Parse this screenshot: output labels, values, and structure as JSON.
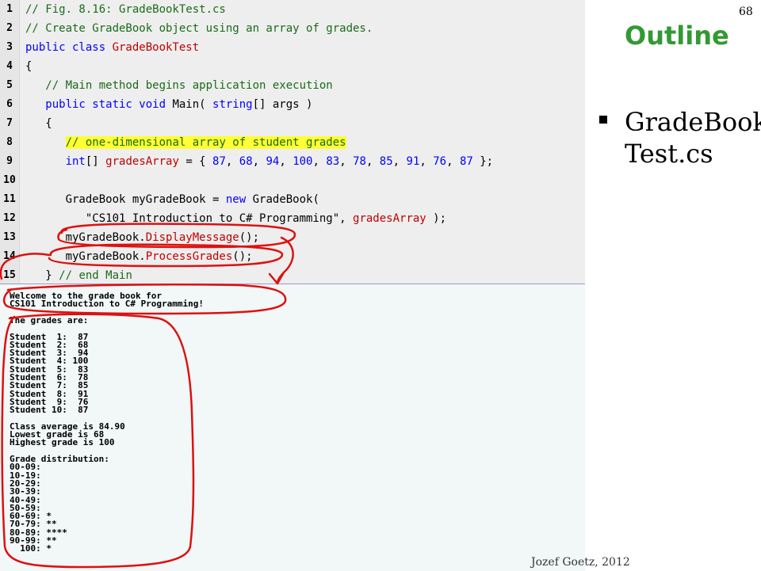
{
  "slide": {
    "page_number": "68",
    "outline_title": "Outline",
    "bullet_text": "GradeBook Test.cs",
    "footer": "Jozef Goetz, 2012"
  },
  "code": [
    {
      "n": "1",
      "tokens": [
        {
          "t": "// Fig. 8.16: GradeBookTest.cs",
          "c": "cm"
        }
      ]
    },
    {
      "n": "2",
      "tokens": [
        {
          "t": "// Create GradeBook object using an array of grades.",
          "c": "cm"
        }
      ]
    },
    {
      "n": "3",
      "tokens": [
        {
          "t": "public class ",
          "c": "kw"
        },
        {
          "t": "GradeBookTest",
          "c": "cls"
        }
      ]
    },
    {
      "n": "4",
      "tokens": [
        {
          "t": "{",
          "c": ""
        }
      ]
    },
    {
      "n": "5",
      "tokens": [
        {
          "t": "   // Main method begins application execution",
          "c": "cm"
        }
      ]
    },
    {
      "n": "6",
      "tokens": [
        {
          "t": "   public static void ",
          "c": "kw"
        },
        {
          "t": "Main( ",
          "c": ""
        },
        {
          "t": "string",
          "c": "kw"
        },
        {
          "t": "[] args )",
          "c": ""
        }
      ]
    },
    {
      "n": "7",
      "tokens": [
        {
          "t": "   {",
          "c": ""
        }
      ]
    },
    {
      "n": "8",
      "tokens": [
        {
          "t": "      ",
          "c": ""
        },
        {
          "t": "// one-dimensional array of student grades",
          "c": "cm hl"
        }
      ]
    },
    {
      "n": "9",
      "tokens": [
        {
          "t": "      ",
          "c": ""
        },
        {
          "t": "int",
          "c": "kw"
        },
        {
          "t": "[] ",
          "c": ""
        },
        {
          "t": "gradesArray",
          "c": "cls"
        },
        {
          "t": " = { ",
          "c": ""
        },
        {
          "t": "87",
          "c": "num"
        },
        {
          "t": ", ",
          "c": ""
        },
        {
          "t": "68",
          "c": "num"
        },
        {
          "t": ", ",
          "c": ""
        },
        {
          "t": "94",
          "c": "num"
        },
        {
          "t": ", ",
          "c": ""
        },
        {
          "t": "100",
          "c": "num"
        },
        {
          "t": ", ",
          "c": ""
        },
        {
          "t": "83",
          "c": "num"
        },
        {
          "t": ", ",
          "c": ""
        },
        {
          "t": "78",
          "c": "num"
        },
        {
          "t": ", ",
          "c": ""
        },
        {
          "t": "85",
          "c": "num"
        },
        {
          "t": ", ",
          "c": ""
        },
        {
          "t": "91",
          "c": "num"
        },
        {
          "t": ", ",
          "c": ""
        },
        {
          "t": "76",
          "c": "num"
        },
        {
          "t": ", ",
          "c": ""
        },
        {
          "t": "87",
          "c": "num"
        },
        {
          "t": " };",
          "c": ""
        }
      ]
    },
    {
      "n": "10",
      "tokens": [
        {
          "t": "",
          "c": ""
        }
      ]
    },
    {
      "n": "11",
      "tokens": [
        {
          "t": "      GradeBook myGradeBook = ",
          "c": ""
        },
        {
          "t": "new",
          "c": "kw"
        },
        {
          "t": " GradeBook(",
          "c": ""
        }
      ]
    },
    {
      "n": "12",
      "tokens": [
        {
          "t": "         \"CS101 Introduction to C# Programming\"",
          "c": "str"
        },
        {
          "t": ", ",
          "c": ""
        },
        {
          "t": "gradesArray",
          "c": "cls"
        },
        {
          "t": " );",
          "c": ""
        }
      ]
    },
    {
      "n": "13",
      "tokens": [
        {
          "t": "      myGradeBook.",
          "c": ""
        },
        {
          "t": "DisplayMessage",
          "c": "cls"
        },
        {
          "t": "();",
          "c": ""
        }
      ]
    },
    {
      "n": "14",
      "tokens": [
        {
          "t": "      myGradeBook.",
          "c": ""
        },
        {
          "t": "ProcessGrades",
          "c": "cls"
        },
        {
          "t": "();",
          "c": ""
        }
      ]
    },
    {
      "n": "15",
      "tokens": [
        {
          "t": "   } ",
          "c": ""
        },
        {
          "t": "// end Main",
          "c": "cm"
        }
      ]
    }
  ],
  "console_output": [
    "Welcome to the grade book for",
    "CS101 Introduction to C# Programming!",
    "",
    "The grades are:",
    "",
    "Student  1:  87",
    "Student  2:  68",
    "Student  3:  94",
    "Student  4: 100",
    "Student  5:  83",
    "Student  6:  78",
    "Student  7:  85",
    "Student  8:  91",
    "Student  9:  76",
    "Student 10:  87",
    "",
    "Class average is 84.90",
    "Lowest grade is 68",
    "Highest grade is 100",
    "",
    "Grade distribution:",
    "00-09:",
    "10-19:",
    "20-29:",
    "30-39:",
    "40-49:",
    "50-59:",
    "60-69: *",
    "70-79: **",
    "80-89: ****",
    "90-99: **",
    "  100: *"
  ],
  "colors": {
    "outline_title": "#339933",
    "annotation": "#dd1111",
    "highlight": "#ffff33"
  }
}
